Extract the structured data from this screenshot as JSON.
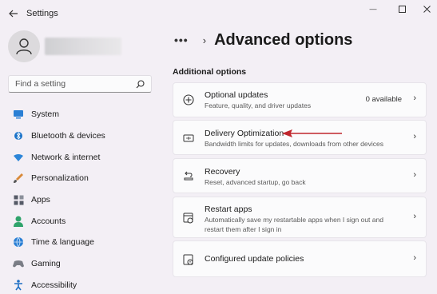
{
  "titlebar": {
    "title": "Settings",
    "minimize_glyph": "—",
    "maximize_glyph": "☐",
    "close_glyph": "✕"
  },
  "search": {
    "placeholder": "Find a setting"
  },
  "sidebar": {
    "items": [
      {
        "label": "System",
        "icon": "system-icon",
        "color": "#2a7fd4"
      },
      {
        "label": "Bluetooth & devices",
        "icon": "bluetooth-icon",
        "color": "#1a73c9"
      },
      {
        "label": "Network & internet",
        "icon": "wifi-icon",
        "color": "#2c85d8"
      },
      {
        "label": "Personalization",
        "icon": "brush-icon",
        "color": "#d98a3a"
      },
      {
        "label": "Apps",
        "icon": "apps-icon",
        "color": "#555a66"
      },
      {
        "label": "Accounts",
        "icon": "accounts-icon",
        "color": "#2fa36b"
      },
      {
        "label": "Time & language",
        "icon": "globe-icon",
        "color": "#2a7fd4"
      },
      {
        "label": "Gaming",
        "icon": "gaming-icon",
        "color": "#7a7d85"
      },
      {
        "label": "Accessibility",
        "icon": "accessibility-icon",
        "color": "#1e6fc4"
      }
    ]
  },
  "main": {
    "breadcrumb_more": "•••",
    "breadcrumb_sep": "›",
    "title": "Advanced options",
    "section": "Additional options",
    "cards": [
      {
        "title": "Optional updates",
        "desc": "Feature, quality, and driver updates",
        "value": "0 available",
        "icon": "plus-circle-icon"
      },
      {
        "title": "Delivery Optimization",
        "desc": "Bandwidth limits for updates, downloads from other devices",
        "value": "",
        "icon": "delivery-icon"
      },
      {
        "title": "Recovery",
        "desc": "Reset, advanced startup, go back",
        "value": "",
        "icon": "recovery-icon"
      },
      {
        "title": "Restart apps",
        "desc": "Automatically save my restartable apps when I sign out and restart them after I sign in",
        "value": "",
        "icon": "restart-apps-icon"
      },
      {
        "title": "Configured update policies",
        "desc": "",
        "value": "",
        "icon": "policy-icon"
      }
    ],
    "chevron": "›"
  },
  "annotation": {
    "arrow_color": "#c0262d"
  }
}
